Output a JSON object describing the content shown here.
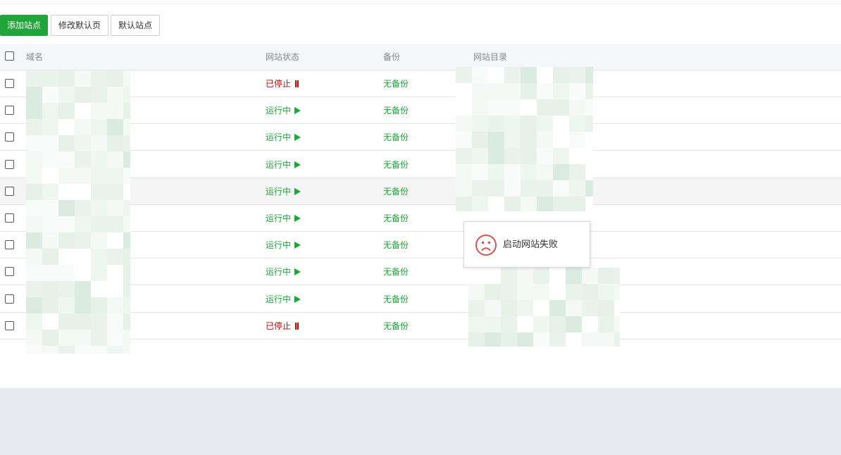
{
  "toolbar": {
    "add_site": "添加站点",
    "edit_default_page": "修改默认页",
    "default_site": "默认站点"
  },
  "table": {
    "columns": [
      "域名",
      "网站状态",
      "备份",
      "网站目录"
    ],
    "rows": [
      {
        "status": "已停止",
        "state": "stopped",
        "backup": "无备份"
      },
      {
        "status": "运行中",
        "state": "running",
        "backup": "无备份"
      },
      {
        "status": "运行中",
        "state": "running",
        "backup": "无备份"
      },
      {
        "status": "运行中",
        "state": "running",
        "backup": "无备份"
      },
      {
        "status": "运行中",
        "state": "running",
        "backup": "无备份"
      },
      {
        "status": "运行中",
        "state": "running",
        "backup": "无备份"
      },
      {
        "status": "运行中",
        "state": "running",
        "backup": "无备份"
      },
      {
        "status": "运行中",
        "state": "running",
        "backup": "无备份"
      },
      {
        "status": "运行中",
        "state": "running",
        "backup": "无备份"
      },
      {
        "status": "已停止",
        "state": "stopped",
        "backup": "无备份"
      }
    ]
  },
  "toast": {
    "message": "启动网站失败",
    "icon": "sad-face-icon"
  },
  "colors": {
    "primary": "#20a53a",
    "stopped": "#cc0000",
    "running": "#20a53a"
  }
}
